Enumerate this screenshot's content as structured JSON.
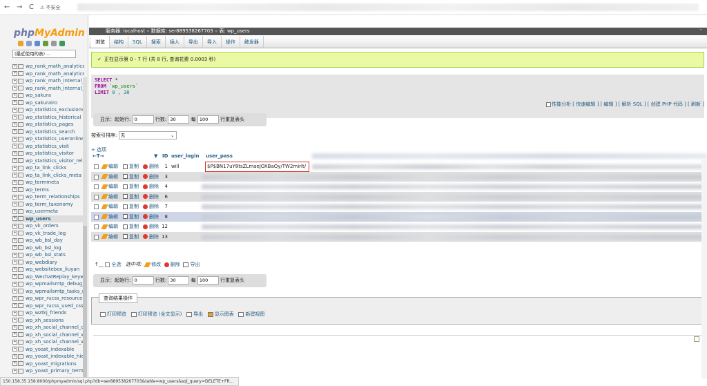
{
  "browser": {
    "back": "←",
    "forward": "→",
    "reload": "C",
    "security_label": "不安全"
  },
  "sidebar": {
    "logo_php": "php",
    "logo_myadmin": "MyAdmin",
    "recent_select": "(最近使用的表) ...",
    "tables": [
      "wp_rank_math_analytics",
      "wp_rank_math_analytics",
      "wp_rank_math_internal_",
      "wp_rank_math_internal_",
      "wp_sakura",
      "wp_sakurairo",
      "wp_statistics_exclusions",
      "wp_statistics_historical",
      "wp_statistics_pages",
      "wp_statistics_search",
      "wp_statistics_useronline",
      "wp_statistics_visit",
      "wp_statistics_visitor",
      "wp_statistics_visitor_rela",
      "wp_ta_link_clicks",
      "wp_ta_link_clicks_meta",
      "wp_termmeta",
      "wp_terms",
      "wp_term_relationships",
      "wp_term_taxonomy",
      "wp_usermeta",
      "wp_users",
      "wp_vk_orders",
      "wp_vk_trade_log",
      "wp_wb_bsl_day",
      "wp_wb_bsl_log",
      "wp_wb_bsl_stats",
      "wp_webdiary",
      "wp_websitebox_liuyan",
      "wp_WechatReplay_keyw",
      "wp_wpmailsmtp_debug_",
      "wp_wpmailsmtp_tasks_r",
      "wp_wpr_rucss_resources",
      "wp_wpr_rucss_used_css",
      "wp_wztkj_friends",
      "wp_xh_sessions",
      "wp_xh_social_channel_q",
      "wp_xh_social_channel_w",
      "wp_xh_social_channel_w",
      "wp_yoast_indexable",
      "wp_yoast_indexable_hie",
      "wp_yoast_migrations",
      "wp_yoast_primary_term"
    ],
    "selected_table": "wp_users"
  },
  "breadcrumb": {
    "server": "服务器: localhost",
    "database": "数据库: ser889538267703",
    "table": "表: wp_users"
  },
  "tabs": [
    "浏览",
    "结构",
    "SQL",
    "搜索",
    "插入",
    "导出",
    "导入",
    "操作",
    "触发器"
  ],
  "success_message": "正在显示第 0 - 7 行 (共 8 行, 查询花费 0.0003 秒)",
  "sql": {
    "select_kw": "SELECT",
    "star": " *",
    "from_kw": "FROM",
    "table": " `wp_users`",
    "limit_kw": "LIMIT",
    "limit_vals": " 0 , 30"
  },
  "sql_links": "性能分析 [ 快速编辑 ] [ 编辑 ] [ 解析 SQL ] [ 创建 PHP 代码 ] [ 刷新 ]",
  "navigation": {
    "show_label": "显示：",
    "start_label": "起始行:",
    "start_value": "0",
    "rows_label": "行数:",
    "rows_value": "30",
    "every_label": "每",
    "every_value": "100",
    "repeat_label": "行重复表头"
  },
  "sort": {
    "label": "按索引排序:",
    "value": "无"
  },
  "options_link": "+ 选项",
  "columns": {
    "id": "ID",
    "user_login": "user_login",
    "user_pass": "user_pass"
  },
  "row_actions": {
    "edit": "编辑",
    "copy": "复制",
    "delete": "删除"
  },
  "rows": [
    {
      "id": "1",
      "login": "will",
      "pass": "$P$BN17uY8tsZLmaeJOXBaOy/TW2mirlt/"
    },
    {
      "id": "3"
    },
    {
      "id": "4"
    },
    {
      "id": "6"
    },
    {
      "id": "7"
    },
    {
      "id": "8"
    },
    {
      "id": "12"
    },
    {
      "id": "13"
    }
  ],
  "bulk": {
    "select_all": "全选",
    "selected": "选中项:",
    "edit": "修改",
    "delete": "删除",
    "export": "导出"
  },
  "query_ops": {
    "legend": "查询结果操作",
    "print": "打印预览",
    "print_full": "打印预览 (全文显示)",
    "export": "导出",
    "chart": "显示图表",
    "view": "新建视图"
  },
  "status_url": "150.158.35.158:8000/phpmyadmin/sql.php?db=ser889538267703&table=wp_users&sql_query=DELETE+FR..."
}
